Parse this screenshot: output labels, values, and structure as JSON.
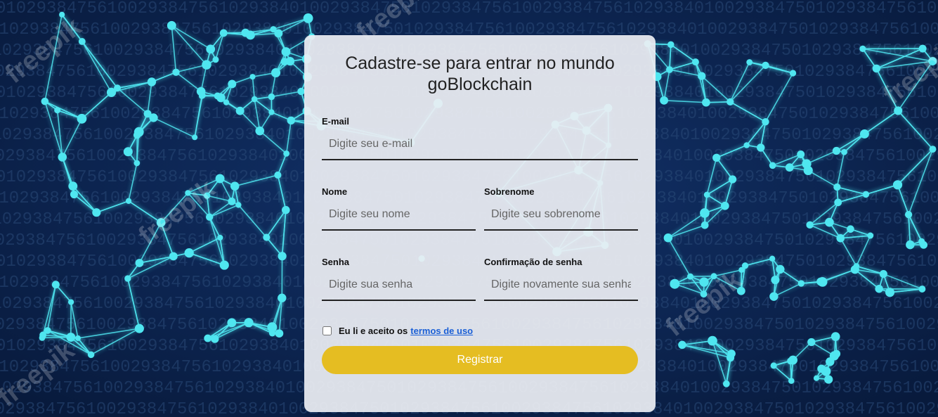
{
  "background": {
    "watermark_text": "freepik",
    "digits_text": "0102938475610029384756102938401002938475",
    "colors": {
      "base": "#0b1f45",
      "network": "#4fe6f0",
      "digits": "#2a4a78"
    }
  },
  "form": {
    "title": "Cadastre-se para entrar no mundo goBlockchain",
    "email": {
      "label": "E-mail",
      "placeholder": "Digite seu e-mail"
    },
    "first_name": {
      "label": "Nome",
      "placeholder": "Digite seu nome"
    },
    "last_name": {
      "label": "Sobrenome",
      "placeholder": "Digite seu sobrenome"
    },
    "password": {
      "label": "Senha",
      "placeholder": "Digite sua senha"
    },
    "password_confirm": {
      "label": "Confirmação de senha",
      "placeholder": "Digite novamente sua senha"
    },
    "terms": {
      "prefix": "Eu li e aceito os",
      "link_label": "termos de uso",
      "checked": false
    },
    "submit_label": "Registrar",
    "colors": {
      "button": "#e5bd22",
      "link": "#1a5fd6"
    }
  }
}
